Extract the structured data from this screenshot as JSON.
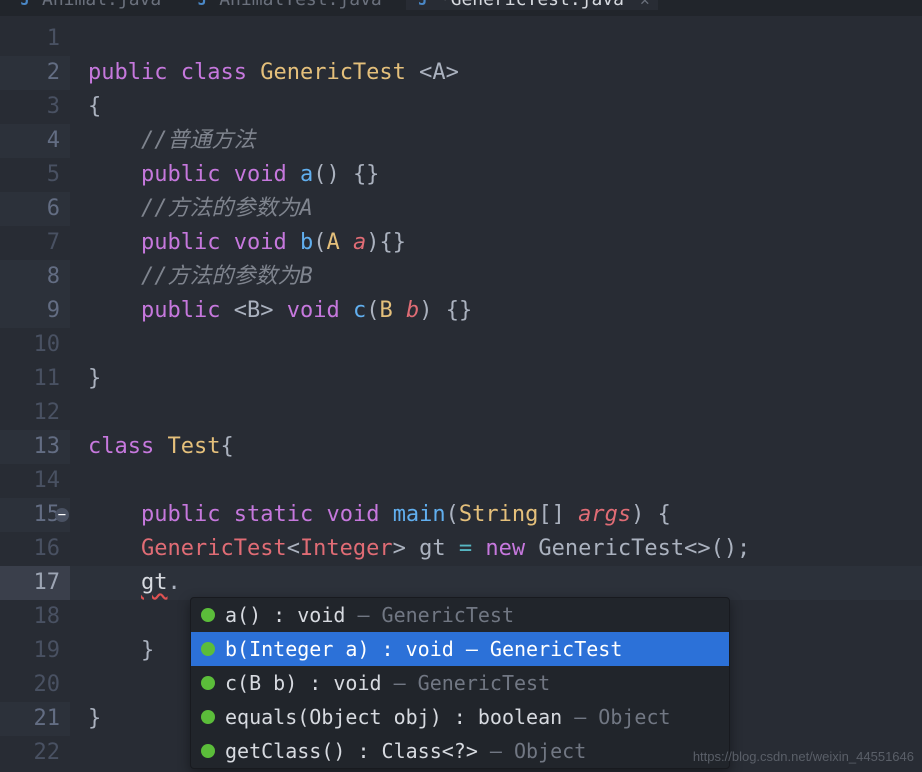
{
  "tabs": [
    {
      "label": "Animal.java",
      "active": false
    },
    {
      "label": "AnimalTest.java",
      "active": false
    },
    {
      "label": "*GenericTest.java",
      "active": true
    }
  ],
  "line_numbers": [
    "1",
    "2",
    "3",
    "4",
    "5",
    "6",
    "7",
    "8",
    "9",
    "10",
    "11",
    "12",
    "13",
    "14",
    "15",
    "16",
    "17",
    "18",
    "19",
    "20",
    "21",
    "22"
  ],
  "code": {
    "l2_public": "public",
    "l2_class": "class",
    "l2_name": "GenericTest",
    "l2_gen": "<A>",
    "l3": "{",
    "l4_cmt": "//普通方法",
    "l5_public": "public",
    "l5_void": "void",
    "l5_name": "a",
    "l5_rest": "() {}",
    "l6_cmt": "//方法的参数为A",
    "l7_public": "public",
    "l7_void": "void",
    "l7_name": "b",
    "l7_p1": "(",
    "l7_pt": "A",
    "l7_pn": "a",
    "l7_p2": "){}",
    "l8_cmt": "//方法的参数为B",
    "l9_public": "public",
    "l9_gen": "<B>",
    "l9_void": "void",
    "l9_name": "c",
    "l9_p1": "(",
    "l9_pt": "B",
    "l9_pn": "b",
    "l9_p2": ") {}",
    "l11": "}",
    "l13_class": "class",
    "l13_name": "Test",
    "l13_br": "{",
    "l15_public": "public",
    "l15_static": "static",
    "l15_void": "void",
    "l15_name": "main",
    "l15_p1": "(",
    "l15_pt": "String",
    "l15_arr": "[]",
    "l15_pn": "args",
    "l15_p2": ") {",
    "l16_t1": "GenericTest",
    "l16_g1": "<",
    "l16_t2": "Integer",
    "l16_g2": ">",
    "l16_var": " gt ",
    "l16_eq": "=",
    "l16_new": " new",
    "l16_t3": " GenericTest",
    "l16_end": "<>();",
    "l17_gt": "gt",
    "l17_dot": ".",
    "l19": "}",
    "l21": "}"
  },
  "autocomplete": {
    "items": [
      {
        "sig": "a() : void",
        "origin": " – GenericTest",
        "selected": false
      },
      {
        "sig": "b(Integer a) : void – GenericTest",
        "origin": "",
        "selected": true
      },
      {
        "sig": "c(B b) : void",
        "origin": " – GenericTest",
        "selected": false
      },
      {
        "sig": "equals(Object obj) : boolean",
        "origin": " – Object",
        "selected": false
      },
      {
        "sig": "getClass() : Class<?>",
        "origin": " – Object",
        "selected": false
      }
    ]
  },
  "watermark": "https://blog.csdn.net/weixin_44551646"
}
